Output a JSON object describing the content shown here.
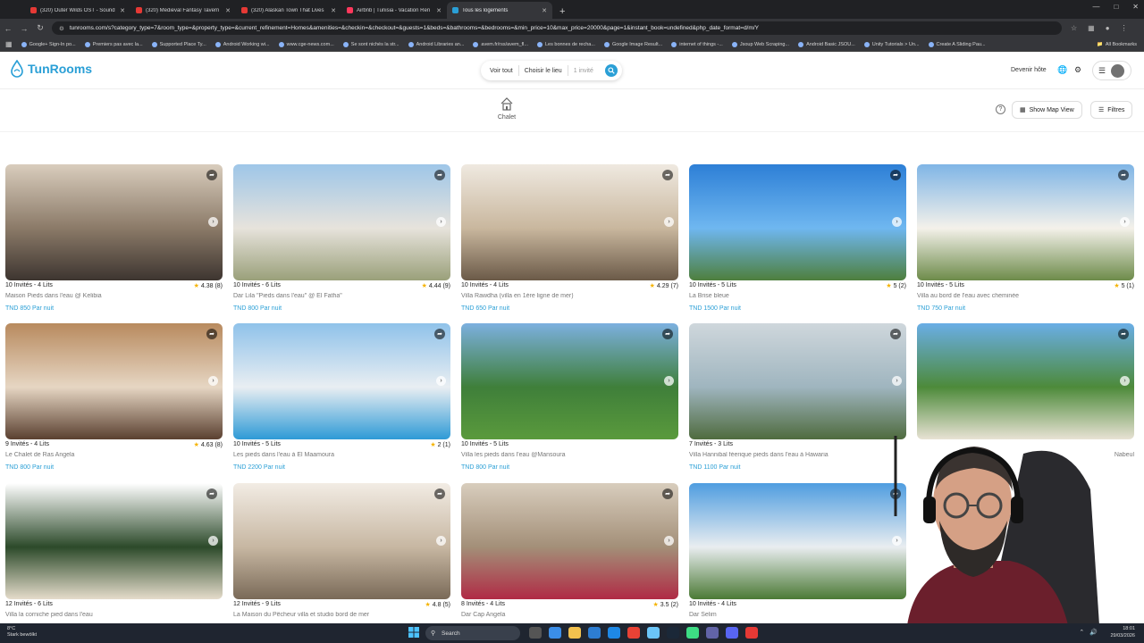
{
  "browser": {
    "tabs": [
      {
        "label": "(320) Outer Wilds OST - Sound",
        "color": "#e53935",
        "active": false
      },
      {
        "label": "(320) Medieval Fantasy Tavern",
        "color": "#e53935",
        "active": false
      },
      {
        "label": "(320) Alaskan Town That Lives",
        "color": "#e53935",
        "active": false
      },
      {
        "label": "Airbnb | Tunisia - Vacation Ren",
        "color": "#ff385c",
        "active": false
      },
      {
        "label": "Tous les logements",
        "color": "#2a9fd6",
        "active": true
      }
    ],
    "new_tab": "+",
    "url": "tunrooms.com/s?category_type=7&room_type=&property_type=&current_refinement=Homes&amenities=&checkin=&checkout=&guests=1&beds=&bathrooms=&bedrooms=&min_price=10&max_price=20000&page=1&instant_book=undefined&php_date_format=d/m/Y",
    "bookmarks": [
      "Google+ Sign-In po...",
      "Premiers pas avec la...",
      "Supported Place Ty...",
      "Android Working wi...",
      "www.cge-news.com...",
      "Se sont nichés la str...",
      "Android Libraries an...",
      "avem.fr/rss/avem_fl...",
      "Les bonnes de recha...",
      "Google Image Result...",
      "internet of things -...",
      "Jsoup Web Scraping...",
      "Android Basic JSOU...",
      "Unity Tutorials > Un...",
      "Create A Sliding Pau..."
    ],
    "all_bookmarks": "All Bookmarks"
  },
  "site": {
    "logo": "TunRooms",
    "brand_color": "#2a9fd6",
    "search": {
      "anywhere": "Voir tout",
      "place": "Choisir le lieu",
      "guests": "1 invité"
    },
    "become_host": "Devenir hôte",
    "category": "Chalet",
    "show_map": "Show Map View",
    "filters": "Filtres",
    "info": "?"
  },
  "listings": [
    {
      "guests_beds": "10 Invités - 4 Lits",
      "rating": "4.38 (8)",
      "title": "Maison Pieds dans l'eau @ Kelibia",
      "price": "TND 850 Par nuit"
    },
    {
      "guests_beds": "10 Invités - 6 Lits",
      "rating": "4.44 (9)",
      "title": "Dar Lila \"Pieds dans l'eau\" @ El Fatha\"",
      "price": "TND 800 Par nuit"
    },
    {
      "guests_beds": "10 Invités - 4 Lits",
      "rating": "4.29 (7)",
      "title": "Villa Rawdha (villa en 1ère ligne de mer)",
      "price": "TND 650 Par nuit"
    },
    {
      "guests_beds": "10 Invités - 5 Lits",
      "rating": "5 (2)",
      "title": "La Brise bleue",
      "price": "TND 1500 Par nuit"
    },
    {
      "guests_beds": "10 Invités - 5 Lits",
      "rating": "5 (1)",
      "title": "Villa au bord de l'eau avec cheminée",
      "price": "TND 750 Par nuit"
    },
    {
      "guests_beds": "9 Invités - 4 Lits",
      "rating": "4.63 (8)",
      "title": "Le Chalet de Ras Angela",
      "price": "TND 800 Par nuit"
    },
    {
      "guests_beds": "10 Invités - 5 Lits",
      "rating": "2 (1)",
      "title": "Les pieds dans l'eau à El Maamoura",
      "price": "TND 2200 Par nuit"
    },
    {
      "guests_beds": "10 Invités - 5 Lits",
      "rating": "",
      "title": "Villa les pieds dans l'eau @Mansoura",
      "price": "TND 800 Par nuit"
    },
    {
      "guests_beds": "7 Invités - 3 Lits",
      "rating": "",
      "title": "Villa Hannibal féerique pieds dans l'eau à Hawaria",
      "price": "TND 1100 Par nuit"
    },
    {
      "guests_beds": "",
      "rating": "",
      "title": "Nabeul",
      "price": ""
    },
    {
      "guests_beds": "12 Invités - 6 Lits",
      "rating": "",
      "title": "Villa la corniche pied dans l'eau",
      "price": ""
    },
    {
      "guests_beds": "12 Invités - 9 Lits",
      "rating": "4.8 (5)",
      "title": "La Maison du Pêcheur villa et studio bord de mer",
      "price": ""
    },
    {
      "guests_beds": "8 Invités - 4 Lits",
      "rating": "3.5 (2)",
      "title": "Dar Cap Angela",
      "price": ""
    },
    {
      "guests_beds": "10 Invités - 4 Lits",
      "rating": "",
      "title": "Dar Selim",
      "price": ""
    }
  ],
  "taskbar": {
    "weather_temp": "8°C",
    "weather_desc": "Stark bewölkt",
    "search": "Search",
    "time": "18:01",
    "date": "29/03/2026"
  }
}
